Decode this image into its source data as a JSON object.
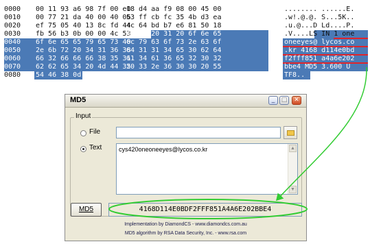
{
  "hexdump": {
    "rows": [
      {
        "offset": "0000",
        "b1": "00 11 93 a6 98 7f 00 e0",
        "b2": "18 d4 aa f9 08 00 45 00",
        "ascii": "........ ......E."
      },
      {
        "offset": "0010",
        "b1": "00 77 21 da 40 00 40 06",
        "b2": "53 ff cb fc 35 4b d3 ea",
        "ascii": ".w!.@.@. S...5K.."
      },
      {
        "offset": "0020",
        "b1": "ef 75 05 40 13 8c fd 44",
        "b2": "4c 64 bd b7 e6 81 50 18",
        "ascii": ".u.@...D Ld....P."
      },
      {
        "offset": "0030",
        "b1": "fb 56 b3 0b 00 00 4c 53",
        "b2": "49 4e 20 31 20 6f 6e 65",
        "ascii": ".V....LS IN 1 one"
      },
      {
        "offset": "0040",
        "b1": "6f 6e 65 65 79 65 73 40",
        "b2": "6c 79 63 6f 73 2e 63 6f",
        "ascii": "oneeyes@ lycos.co"
      },
      {
        "offset": "0050",
        "b1": "2e 6b 72 20 34 31 36 38",
        "b2": "64 31 31 34 65 30 62 64",
        "ascii": ".kr 4168 d114e0bd"
      },
      {
        "offset": "0060",
        "b1": "66 32 66 66 66 38 35 31",
        "b2": "61 34 61 36 65 32 30 32",
        "ascii": "f2fff851 a4a6e202"
      },
      {
        "offset": "0070",
        "b1": "62 62 65 34 20 4d 44 35",
        "b2": "20 33 2e 36 30 30 20 55",
        "ascii": "bbe4 MD5  3.600 U"
      },
      {
        "offset": "0080",
        "b1": "54 46 38 0d 0a",
        "b2": "",
        "ascii": "TF8.."
      }
    ]
  },
  "window": {
    "title": "MD5",
    "min_glyph": "_",
    "max_glyph": "□",
    "close_glyph": "✕",
    "group_label": "Input",
    "file_label": "File",
    "text_label": "Text",
    "file_value": "",
    "text_value": "cys420oneoneeyes@lycos.co.kr",
    "selected_input": "Text",
    "md5_button": "MD5",
    "hash_value": "4168D114E0BDF2FFF851A4A6E202BBE4",
    "credit_line1": "Implementation by DiamondCS - www.diamondcs.com.au",
    "credit_line2": "MD5 algorithm by RSA Data Security, Inc. - www.rsa.com"
  },
  "colors": {
    "selection": "#4b7ab6",
    "underline_red": "#e0242a",
    "annotation_green": "#33cc33"
  },
  "icons": [
    "minimize-icon",
    "maximize-icon",
    "close-icon",
    "folder-icon",
    "scroll-up-arrow-icon",
    "scroll-down-arrow-icon"
  ]
}
